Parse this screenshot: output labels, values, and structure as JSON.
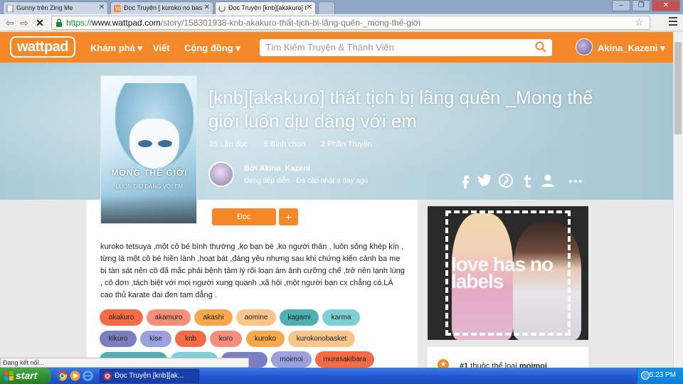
{
  "browser": {
    "tabs": [
      {
        "label": "Gunny trên Zing Me",
        "active": false
      },
      {
        "label": "Đọc Truyện [ kuroko no bas",
        "active": false
      },
      {
        "label": "Đọc Truyện [knb][akakuro] t",
        "active": true
      }
    ],
    "address": {
      "scheme": "https://",
      "host": "www.wattpad.com",
      "path": "/story/158301938-knb-akakuro-thất-tịch-bị-lãng-quên-_mong-thế-giới"
    },
    "status_text": "Đang kết nối..."
  },
  "header": {
    "logo": "wattpad",
    "nav": [
      {
        "label": "Khám phá ▾"
      },
      {
        "label": "Viết"
      },
      {
        "label": "Cộng đồng ▾"
      }
    ],
    "search_placeholder": "Tìm Kiếm Truyện & Thành Viên",
    "username": "Akina_Kazeni ▾"
  },
  "story": {
    "cover_line1": "MONG THẾ GIỚI",
    "cover_line2": "LUÔN DỊU DÀNG VỚI EM",
    "title": "[knb][akakuro] thất tịch bị lãng quên _Mong thế giới luôn dịu dàng với em",
    "stats": [
      "25 Lần đọc",
      "5 Bình chọn",
      "2 Phần Truyện"
    ],
    "author": "Bởi Akina_Kazeni",
    "status": "Đang tiếp diễn - Đã cập nhật a day ago",
    "read_label": "Đọc",
    "add_label": "+",
    "description": "kuroko tetsuya ,một cô bé bình thường ,ko bạn bè ,ko người thân , luôn sống khép kín , từng là một cô bé hiền lành ,hoạt bát ,đáng yêu nhưng sau khi chứng kiến cảnh ba mẹ bị tàn sát nên cô đã mắc phải bệnh tâm lý rối loạn ám ảnh cưỡng chế ,trở nên lạnh lùng , cô đơn ,tách biệt với mọi người xung quanh ,xã hội ,một người bạn cx chẳng có.LÀ cao thủ karate đai đen tam đẳng ."
  },
  "tags": [
    {
      "label": "akakuro",
      "color": "#f46b45"
    },
    {
      "label": "akamuro",
      "color": "#f58f7a"
    },
    {
      "label": "akashi",
      "color": "#f6a94a"
    },
    {
      "label": "aomine",
      "color": "#f8c58a"
    },
    {
      "label": "kagami",
      "color": "#4fb0b1"
    },
    {
      "label": "karma",
      "color": "#7fd0d4"
    },
    {
      "label": "kikuro",
      "color": "#7a7fc2"
    },
    {
      "label": "kise",
      "color": "#9aa1dc"
    },
    {
      "label": "knb",
      "color": "#f46b45"
    },
    {
      "label": "koro",
      "color": "#f58f7a"
    },
    {
      "label": "kuroko",
      "color": "#f6a94a"
    },
    {
      "label": "kurokonobasket",
      "color": "#f8c58a"
    },
    {
      "label": "moimoi",
      "color": "#9aa1dc"
    },
    {
      "label": "murasakibara",
      "color": "#f46b45"
    }
  ],
  "sidebar": {
    "ad_text": "love has no labels",
    "rank_number": "#1",
    "rank_text": " thuộc thể loại ",
    "rank_genre": "moimoi"
  },
  "taskbar": {
    "start_label": "start",
    "window_label": "Đọc Truyện [knb][ak...",
    "clock": "5:23 PM"
  },
  "colors": {
    "accent": "#f5892a",
    "taskbar": "#245edb"
  }
}
